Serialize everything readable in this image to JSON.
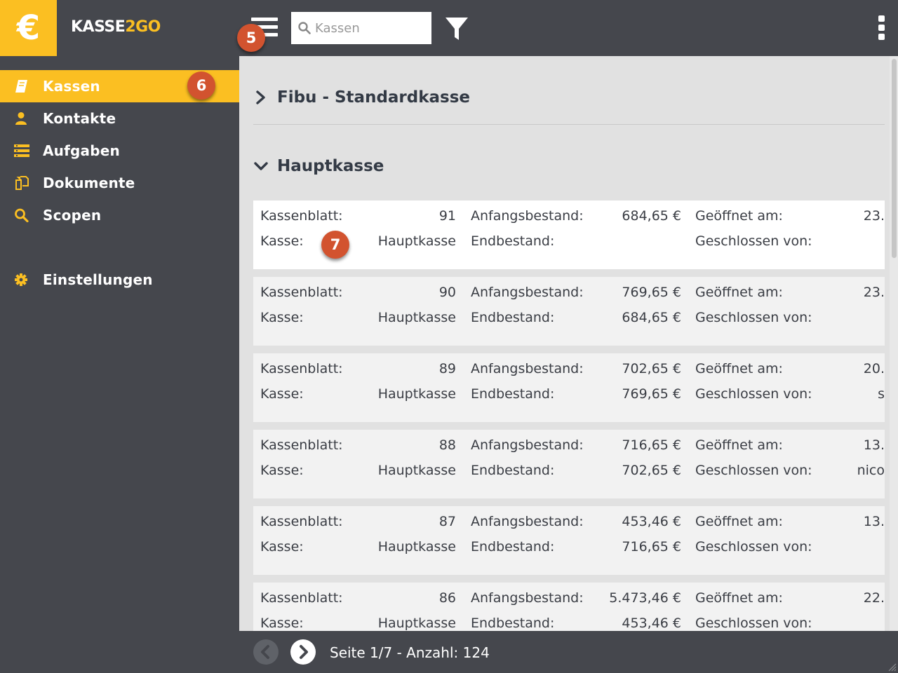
{
  "app": {
    "logo_symbol": "€",
    "brand_prefix": "KASSE",
    "brand_suffix": "2GO",
    "accent_color": "#fbbf22",
    "badge_color": "#d2532f"
  },
  "toolbar": {
    "menu_icon": "hamburger-menu-icon",
    "search_placeholder": "Kassen",
    "search_value": "",
    "filter_icon": "filter-icon",
    "more_icon": "vertical-dots-icon"
  },
  "badges": {
    "menu": "5",
    "sidebar": "6",
    "card": "7"
  },
  "sidebar": {
    "items": [
      {
        "label": "Kassen",
        "icon": "book-icon",
        "active": true
      },
      {
        "label": "Kontakte",
        "icon": "user-icon",
        "active": false
      },
      {
        "label": "Aufgaben",
        "icon": "tasks-icon",
        "active": false
      },
      {
        "label": "Dokumente",
        "icon": "documents-icon",
        "active": false
      },
      {
        "label": "Scopen",
        "icon": "search-icon",
        "active": false
      },
      {
        "label": "Einstellungen",
        "icon": "gear-icon",
        "active": false
      }
    ]
  },
  "groups": [
    {
      "title": "Fibu - Standardkasse",
      "expanded": false
    },
    {
      "title": "Hauptkasse",
      "expanded": true
    }
  ],
  "field_labels": {
    "kassenblatt": "Kassenblatt:",
    "kasse": "Kasse:",
    "anfangsbestand": "Anfangsbestand:",
    "endbestand": "Endbestand:",
    "geoeffnet": "Geöffnet am:",
    "geschlossen": "Geschlossen von:"
  },
  "sheets": [
    {
      "number": "91",
      "kasse": "Hauptkasse",
      "anfangsbestand": "684,65 €",
      "endbestand": "",
      "geoeffnet": "23.",
      "geschlossen": "",
      "selected": true
    },
    {
      "number": "90",
      "kasse": "Hauptkasse",
      "anfangsbestand": "769,65 €",
      "endbestand": "684,65 €",
      "geoeffnet": "23.",
      "geschlossen": "",
      "selected": false
    },
    {
      "number": "89",
      "kasse": "Hauptkasse",
      "anfangsbestand": "702,65 €",
      "endbestand": "769,65 €",
      "geoeffnet": "20.",
      "geschlossen": "s",
      "selected": false
    },
    {
      "number": "88",
      "kasse": "Hauptkasse",
      "anfangsbestand": "716,65 €",
      "endbestand": "702,65 €",
      "geoeffnet": "13.",
      "geschlossen": "nico",
      "selected": false
    },
    {
      "number": "87",
      "kasse": "Hauptkasse",
      "anfangsbestand": "453,46 €",
      "endbestand": "716,65 €",
      "geoeffnet": "13.",
      "geschlossen": "",
      "selected": false
    },
    {
      "number": "86",
      "kasse": "Hauptkasse",
      "anfangsbestand": "5.473,46 €",
      "endbestand": "453,46 €",
      "geoeffnet": "22.",
      "geschlossen": "",
      "selected": false
    }
  ],
  "pagination": {
    "info": "Seite 1/7 - Anzahl: 124",
    "prev_icon": "chevron-left-icon",
    "next_icon": "chevron-right-icon"
  }
}
